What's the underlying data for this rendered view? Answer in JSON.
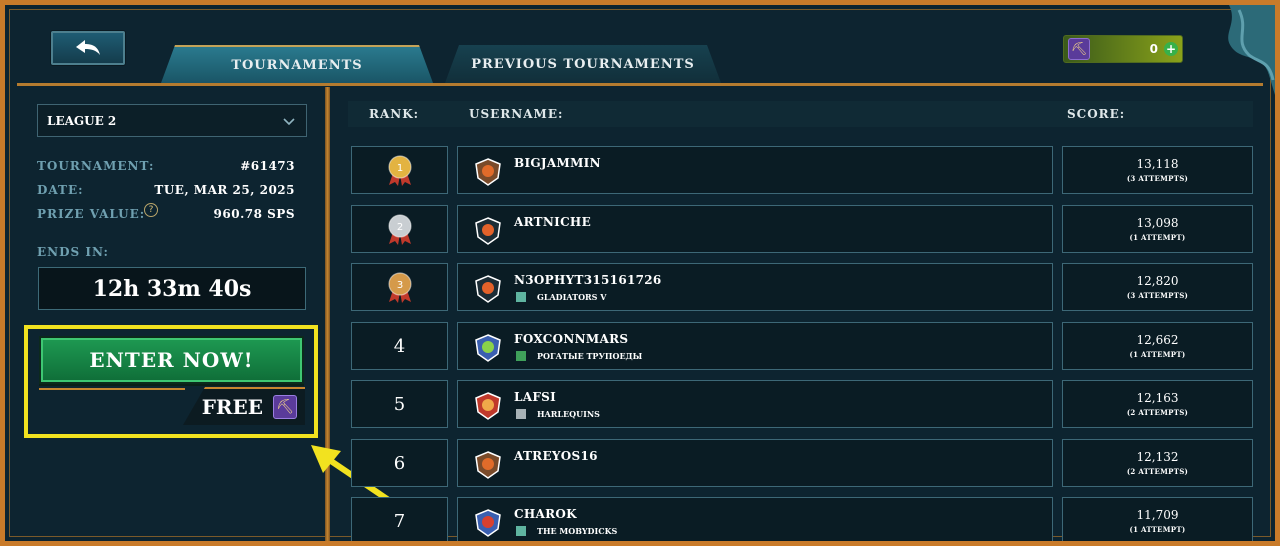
{
  "tabs": [
    {
      "label": "TOURNAMENTS",
      "active": true
    },
    {
      "label": "PREVIOUS TOURNAMENTS",
      "active": false
    }
  ],
  "wallet": {
    "value": "0",
    "plus": "+"
  },
  "league_select": {
    "value": "LEAGUE 2"
  },
  "info": {
    "tournament_label": "TOURNAMENT:",
    "tournament_value": "#61473",
    "date_label": "DATE:",
    "date_value": "TUE, MAR 25, 2025",
    "prize_label": "PRIZE VALUE:",
    "prize_value": "960.78 SPS",
    "help": "?",
    "ends_label": "ENDS IN:",
    "timer": "12h 33m 40s"
  },
  "enter": {
    "label": "ENTER NOW!",
    "free_label": "FREE"
  },
  "columns": {
    "rank": "RANK:",
    "username": "USERNAME:",
    "score": "SCORE:"
  },
  "colors": {
    "gold": "#e3b341",
    "silver": "#c9ced2",
    "bronze": "#d59a4a",
    "highlight": "#f2e21f",
    "accent": "#c7862f"
  },
  "rows": [
    {
      "rank": "1",
      "medal": "gold",
      "username": "BIGJAMMIN",
      "guild": "",
      "score": "13,118",
      "attempts": "(3 ATTEMPTS)"
    },
    {
      "rank": "2",
      "medal": "silver",
      "username": "ARTNICHE",
      "guild": "",
      "score": "13,098",
      "attempts": "(1 ATTEMPT)"
    },
    {
      "rank": "3",
      "medal": "bronze",
      "username": "N3OPHYT315161726",
      "guild": "GLADIATORS V",
      "score": "12,820",
      "attempts": "(3 ATTEMPTS)"
    },
    {
      "rank": "4",
      "medal": "",
      "username": "FOXCONNMARS",
      "guild": "РОГАТЫЕ ТРУПОЕДЫ",
      "score": "12,662",
      "attempts": "(1 ATTEMPT)"
    },
    {
      "rank": "5",
      "medal": "",
      "username": "LAFSI",
      "guild": "HARLEQUINS",
      "score": "12,163",
      "attempts": "(2 ATTEMPTS)"
    },
    {
      "rank": "6",
      "medal": "",
      "username": "ATREYOS16",
      "guild": "",
      "score": "12,132",
      "attempts": "(2 ATTEMPTS)"
    },
    {
      "rank": "7",
      "medal": "",
      "username": "CHAROK",
      "guild": "THE MOBYDICKS",
      "score": "11,709",
      "attempts": "(1 ATTEMPT)"
    }
  ]
}
